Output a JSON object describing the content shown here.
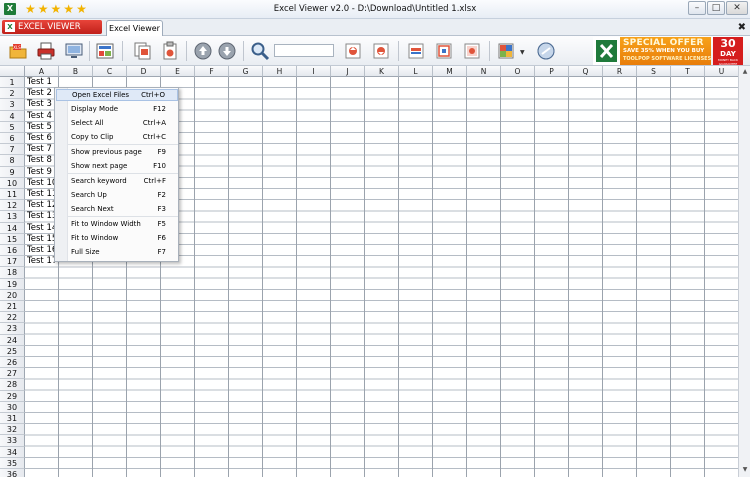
{
  "window": {
    "title": "Excel Viewer v2.0 - D:\\Download\\Untitled 1.xlsx",
    "rating_stars": 5,
    "controls": {
      "minimize": "–",
      "maximize": "□",
      "close": "✕"
    }
  },
  "tabs": {
    "brand_label": "EXCEL VIEWER",
    "document_tab": "Excel Viewer",
    "close_glyph": "✖"
  },
  "ad": {
    "headline": "SPECIAL OFFER",
    "line1": "SAVE 35% WHEN YOU BUY",
    "line2": "TOOLPOP SOFTWARE LICENSES",
    "days_number": "30",
    "days_label": "DAY",
    "guarantee": "MONEY BACK GUARANTEE"
  },
  "sheet": {
    "columns": [
      "A",
      "B",
      "C",
      "D",
      "E",
      "F",
      "G",
      "H",
      "I",
      "J",
      "K",
      "L",
      "M",
      "N",
      "O",
      "P",
      "Q",
      "R",
      "S",
      "T",
      "U"
    ],
    "row_count": 37,
    "cells_a": {
      "1": "Test 1",
      "2": "Test 2",
      "3": "Test 3",
      "4": "Test 4",
      "5": "Test 5",
      "6": "Test 6",
      "7": "Test 7",
      "8": "Test 8",
      "9": "Test 9",
      "10": "Test 10",
      "11": "Test 11",
      "12": "Test 12",
      "13": "Test 13",
      "14": "Test 14",
      "15": "Test 15",
      "16": "Test 16",
      "17": "Test 17"
    }
  },
  "context_menu": {
    "items": [
      {
        "label": "Open Excel Files",
        "shortcut": "Ctrl+O",
        "highlighted": true
      },
      {
        "label": "Display Mode",
        "shortcut": "F12"
      },
      {
        "label": "Select All",
        "shortcut": "Ctrl+A"
      },
      {
        "label": "Copy to Clip",
        "shortcut": "Ctrl+C"
      },
      {
        "label": "Show previous page",
        "shortcut": "F9"
      },
      {
        "label": "Show next page",
        "shortcut": "F10"
      },
      {
        "label": "Search keyword",
        "shortcut": "Ctrl+F"
      },
      {
        "label": "Search Up",
        "shortcut": "F2"
      },
      {
        "label": "Search Next",
        "shortcut": "F3"
      },
      {
        "label": "Fit to Window Width",
        "shortcut": "F5"
      },
      {
        "label": "Fit to Window",
        "shortcut": "F6"
      },
      {
        "label": "Full Size",
        "shortcut": "F7"
      }
    ]
  },
  "colors": {
    "brand_red": "#d32a22",
    "ad_orange": "#f29016",
    "ad_red": "#d51d1d",
    "menu_highlight": "#dfe9f7"
  }
}
